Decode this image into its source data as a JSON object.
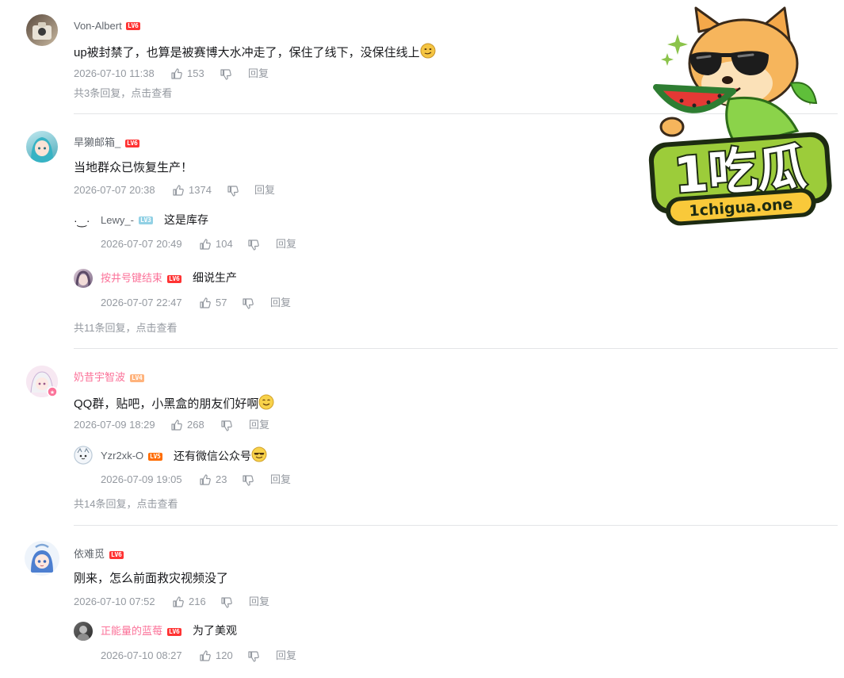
{
  "comments": [
    {
      "user": "Von-Albert",
      "level": "LV6",
      "text": "up被封禁了，也算是被赛博大水冲走了，保住了线下，没保住线上",
      "emoji": "doge",
      "time": "2026-07-10 11:38",
      "likes": "153",
      "reply_label": "回复",
      "more": "共3条回复，点击查看",
      "replies": []
    },
    {
      "user": "旱獭邮箱_",
      "level": "LV6",
      "text": "当地群众已恢复生产！",
      "time": "2026-07-07 20:38",
      "likes": "1374",
      "reply_label": "回复",
      "more": "共11条回复，点击查看",
      "replies": [
        {
          "avatar": "·‿·",
          "user": "Lewy_-",
          "level": "LV3",
          "text": "这是库存",
          "time": "2026-07-07 20:49",
          "likes": "104",
          "reply_label": "回复"
        },
        {
          "user": "按井号键结束",
          "level": "LV6",
          "text": "细说生产",
          "time": "2026-07-07 22:47",
          "likes": "57",
          "reply_label": "回复"
        }
      ]
    },
    {
      "user": "奶昔宇智波",
      "level": "LV4",
      "text": "QQ群，贴吧，小黑盒的朋友们好啊",
      "emoji": "smile",
      "time": "2026-07-09 18:29",
      "likes": "268",
      "reply_label": "回复",
      "more": "共14条回复，点击查看",
      "replies": [
        {
          "user": "Yzr2xk-O",
          "level": "LV5",
          "text": "还有微信公众号",
          "emoji": "cool",
          "time": "2026-07-09 19:05",
          "likes": "23",
          "reply_label": "回复"
        }
      ]
    },
    {
      "user": "依难觅",
      "level": "LV6",
      "text": "刚来，怎么前面救灾视频没了",
      "time": "2026-07-10 07:52",
      "likes": "216",
      "reply_label": "回复",
      "replies": [
        {
          "user": "正能量的蓝莓",
          "level": "LV6",
          "text": "为了美观",
          "time": "2026-07-10 08:27",
          "likes": "120",
          "reply_label": "回复"
        }
      ]
    }
  ],
  "watermark": {
    "brand": "1吃瓜",
    "domain": "1chigua.one"
  },
  "colors": {
    "accent_pink": "#fb7299",
    "meta_gray": "#9499a0",
    "lv6": "#ff3333",
    "lv5": "#ff6c00",
    "lv4": "#ffb37c",
    "lv3": "#92d1e5"
  },
  "icons": [
    "thumb-up-icon",
    "thumb-down-icon",
    "doge-emoji",
    "smile-emoji",
    "cool-emoji"
  ]
}
